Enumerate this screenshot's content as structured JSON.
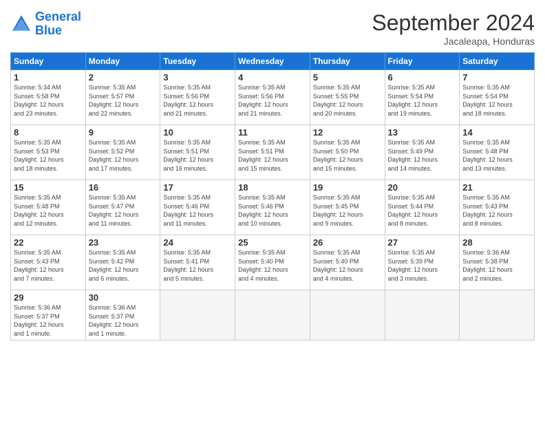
{
  "logo": {
    "line1": "General",
    "line2": "Blue"
  },
  "title": "September 2024",
  "location": "Jacaleapa, Honduras",
  "weekdays": [
    "Sunday",
    "Monday",
    "Tuesday",
    "Wednesday",
    "Thursday",
    "Friday",
    "Saturday"
  ],
  "weeks": [
    [
      {
        "day": "1",
        "info": "Sunrise: 5:34 AM\nSunset: 5:58 PM\nDaylight: 12 hours\nand 23 minutes."
      },
      {
        "day": "2",
        "info": "Sunrise: 5:35 AM\nSunset: 5:57 PM\nDaylight: 12 hours\nand 22 minutes."
      },
      {
        "day": "3",
        "info": "Sunrise: 5:35 AM\nSunset: 5:56 PM\nDaylight: 12 hours\nand 21 minutes."
      },
      {
        "day": "4",
        "info": "Sunrise: 5:35 AM\nSunset: 5:56 PM\nDaylight: 12 hours\nand 21 minutes."
      },
      {
        "day": "5",
        "info": "Sunrise: 5:35 AM\nSunset: 5:55 PM\nDaylight: 12 hours\nand 20 minutes."
      },
      {
        "day": "6",
        "info": "Sunrise: 5:35 AM\nSunset: 5:54 PM\nDaylight: 12 hours\nand 19 minutes."
      },
      {
        "day": "7",
        "info": "Sunrise: 5:35 AM\nSunset: 5:54 PM\nDaylight: 12 hours\nand 18 minutes."
      }
    ],
    [
      {
        "day": "8",
        "info": "Sunrise: 5:35 AM\nSunset: 5:53 PM\nDaylight: 12 hours\nand 18 minutes."
      },
      {
        "day": "9",
        "info": "Sunrise: 5:35 AM\nSunset: 5:52 PM\nDaylight: 12 hours\nand 17 minutes."
      },
      {
        "day": "10",
        "info": "Sunrise: 5:35 AM\nSunset: 5:51 PM\nDaylight: 12 hours\nand 16 minutes."
      },
      {
        "day": "11",
        "info": "Sunrise: 5:35 AM\nSunset: 5:51 PM\nDaylight: 12 hours\nand 15 minutes."
      },
      {
        "day": "12",
        "info": "Sunrise: 5:35 AM\nSunset: 5:50 PM\nDaylight: 12 hours\nand 15 minutes."
      },
      {
        "day": "13",
        "info": "Sunrise: 5:35 AM\nSunset: 5:49 PM\nDaylight: 12 hours\nand 14 minutes."
      },
      {
        "day": "14",
        "info": "Sunrise: 5:35 AM\nSunset: 5:48 PM\nDaylight: 12 hours\nand 13 minutes."
      }
    ],
    [
      {
        "day": "15",
        "info": "Sunrise: 5:35 AM\nSunset: 5:48 PM\nDaylight: 12 hours\nand 12 minutes."
      },
      {
        "day": "16",
        "info": "Sunrise: 5:35 AM\nSunset: 5:47 PM\nDaylight: 12 hours\nand 11 minutes."
      },
      {
        "day": "17",
        "info": "Sunrise: 5:35 AM\nSunset: 5:46 PM\nDaylight: 12 hours\nand 11 minutes."
      },
      {
        "day": "18",
        "info": "Sunrise: 5:35 AM\nSunset: 5:46 PM\nDaylight: 12 hours\nand 10 minutes."
      },
      {
        "day": "19",
        "info": "Sunrise: 5:35 AM\nSunset: 5:45 PM\nDaylight: 12 hours\nand 9 minutes."
      },
      {
        "day": "20",
        "info": "Sunrise: 5:35 AM\nSunset: 5:44 PM\nDaylight: 12 hours\nand 8 minutes."
      },
      {
        "day": "21",
        "info": "Sunrise: 5:35 AM\nSunset: 5:43 PM\nDaylight: 12 hours\nand 8 minutes."
      }
    ],
    [
      {
        "day": "22",
        "info": "Sunrise: 5:35 AM\nSunset: 5:43 PM\nDaylight: 12 hours\nand 7 minutes."
      },
      {
        "day": "23",
        "info": "Sunrise: 5:35 AM\nSunset: 5:42 PM\nDaylight: 12 hours\nand 6 minutes."
      },
      {
        "day": "24",
        "info": "Sunrise: 5:35 AM\nSunset: 5:41 PM\nDaylight: 12 hours\nand 5 minutes."
      },
      {
        "day": "25",
        "info": "Sunrise: 5:35 AM\nSunset: 5:40 PM\nDaylight: 12 hours\nand 4 minutes."
      },
      {
        "day": "26",
        "info": "Sunrise: 5:35 AM\nSunset: 5:40 PM\nDaylight: 12 hours\nand 4 minutes."
      },
      {
        "day": "27",
        "info": "Sunrise: 5:35 AM\nSunset: 5:39 PM\nDaylight: 12 hours\nand 3 minutes."
      },
      {
        "day": "28",
        "info": "Sunrise: 5:36 AM\nSunset: 5:38 PM\nDaylight: 12 hours\nand 2 minutes."
      }
    ],
    [
      {
        "day": "29",
        "info": "Sunrise: 5:36 AM\nSunset: 5:37 PM\nDaylight: 12 hours\nand 1 minute."
      },
      {
        "day": "30",
        "info": "Sunrise: 5:36 AM\nSunset: 5:37 PM\nDaylight: 12 hours\nand 1 minute."
      },
      {
        "day": "",
        "info": ""
      },
      {
        "day": "",
        "info": ""
      },
      {
        "day": "",
        "info": ""
      },
      {
        "day": "",
        "info": ""
      },
      {
        "day": "",
        "info": ""
      }
    ]
  ]
}
